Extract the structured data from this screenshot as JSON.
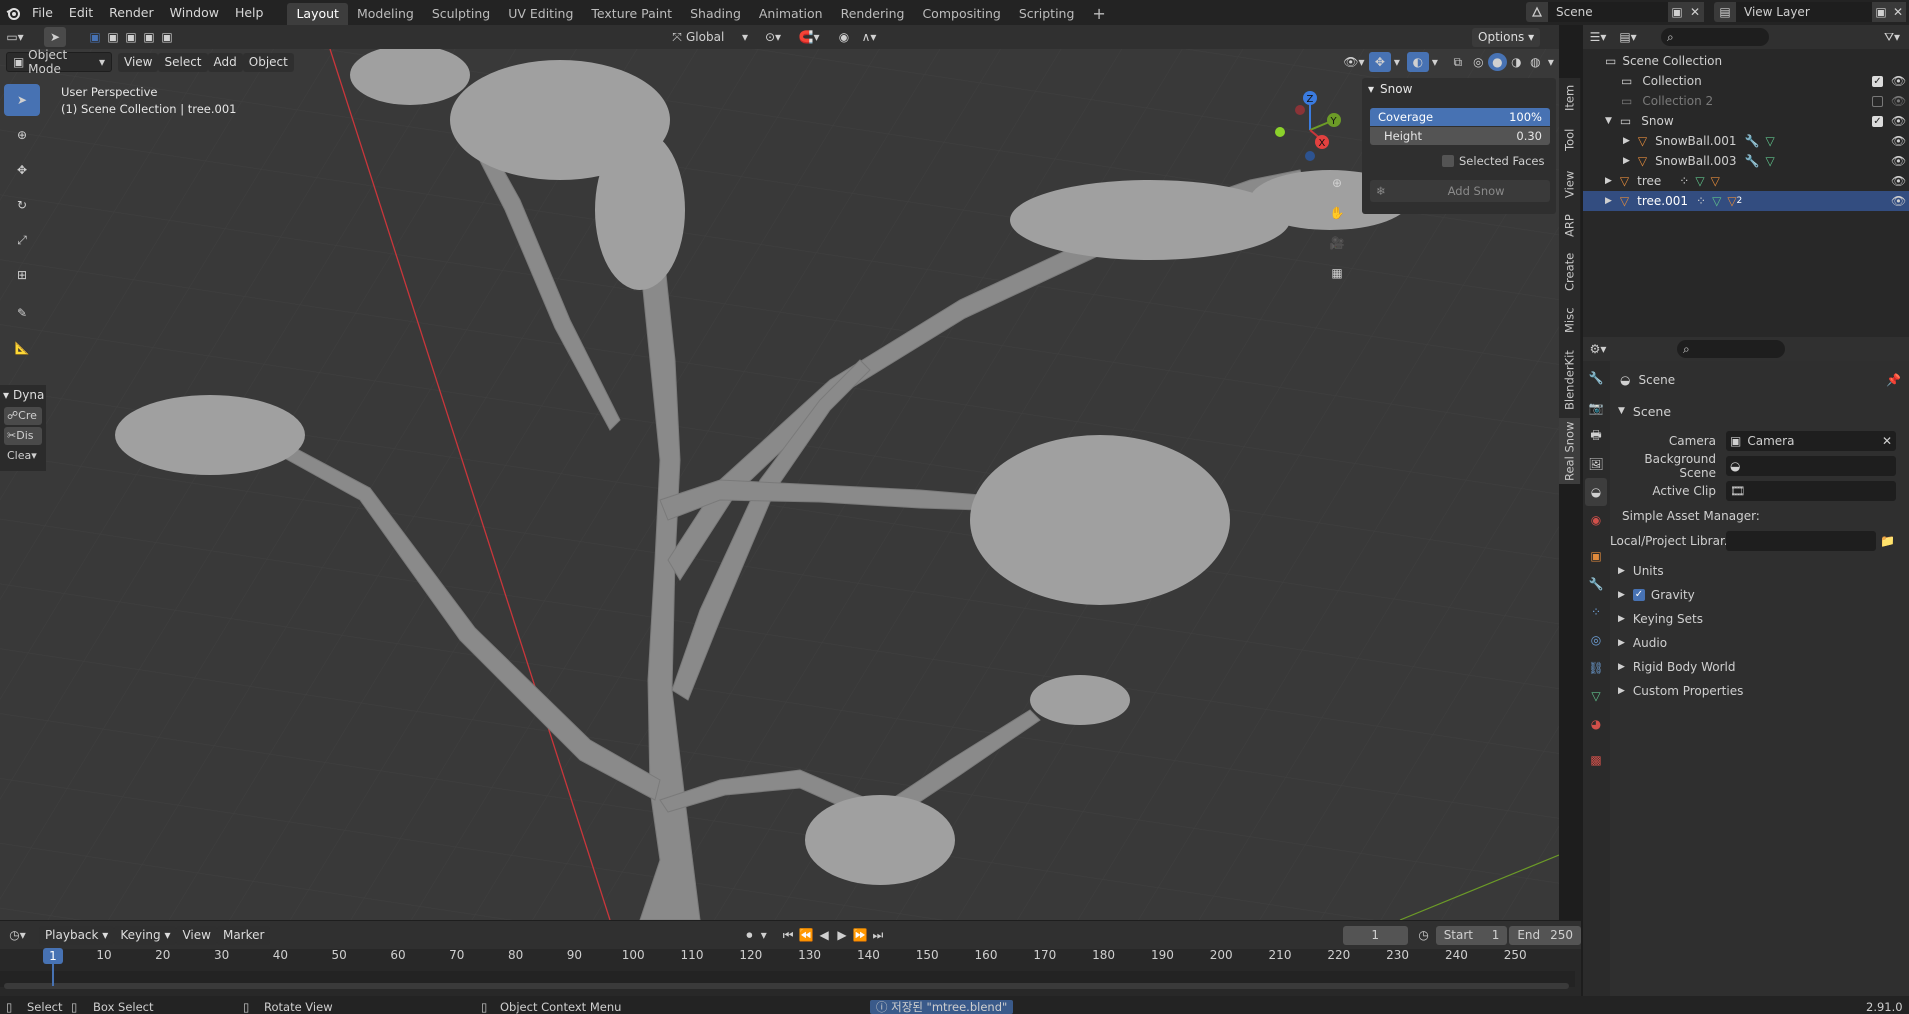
{
  "topbar": {
    "menus": [
      "File",
      "Edit",
      "Render",
      "Window",
      "Help"
    ],
    "workspaces": [
      "Layout",
      "Modeling",
      "Sculpting",
      "UV Editing",
      "Texture Paint",
      "Shading",
      "Animation",
      "Rendering",
      "Compositing",
      "Scripting"
    ],
    "active_workspace": "Layout",
    "scene_name": "Scene",
    "view_layer": "View Layer"
  },
  "viewport_header": {
    "mode": "Object Mode",
    "menus": [
      "View",
      "Select",
      "Add",
      "Object"
    ],
    "transform_orientation": "Global",
    "options_label": "Options"
  },
  "viewport": {
    "perspective_label": "User Perspective",
    "collection_label": "(1) Scene Collection | tree.001",
    "operator_panel": {
      "title": "Dyna",
      "items": [
        "Cre",
        "Dis",
        "Clea"
      ]
    }
  },
  "snow_panel": {
    "title": "Snow",
    "coverage_label": "Coverage",
    "coverage_value": "100%",
    "height_label": "Height",
    "height_value": "0.30",
    "selected_faces_label": "Selected Faces",
    "add_snow_label": "Add Snow"
  },
  "sidebar_tabs": [
    "Item",
    "Tool",
    "View",
    "ARP",
    "Create",
    "Misc",
    "BlenderKit",
    "Real Snow"
  ],
  "outliner": {
    "root": "Scene Collection",
    "items": [
      {
        "label": "Collection",
        "indent": 1
      },
      {
        "label": "Collection 2",
        "indent": 1
      },
      {
        "label": "Snow",
        "indent": 1
      },
      {
        "label": "SnowBall.001",
        "indent": 2
      },
      {
        "label": "SnowBall.003",
        "indent": 2
      },
      {
        "label": "tree",
        "indent": 1
      },
      {
        "label": "tree.001",
        "indent": 1
      }
    ],
    "tree001_badge": "2"
  },
  "properties": {
    "context_title": "Scene",
    "section_scene": "Scene",
    "camera_label": "Camera",
    "camera_value": "Camera",
    "background_scene_label": "Background Scene",
    "active_clip_label": "Active Clip",
    "sam_label": "Simple Asset Manager:",
    "local_library_label": "Local/Project Librar...",
    "sections": [
      "Units",
      "Gravity",
      "Keying Sets",
      "Audio",
      "Rigid Body World",
      "Custom Properties"
    ],
    "gravity_checked": true
  },
  "timeline": {
    "menus": [
      "Playback",
      "Keying",
      "View",
      "Marker"
    ],
    "current_frame": "1",
    "start_label": "Start",
    "start_value": "1",
    "end_label": "End",
    "end_value": "250",
    "ruler": [
      "10",
      "20",
      "30",
      "40",
      "50",
      "60",
      "70",
      "80",
      "90",
      "100",
      "110",
      "120",
      "130",
      "140",
      "150",
      "160",
      "170",
      "180",
      "190",
      "200",
      "210",
      "220",
      "230",
      "240",
      "250"
    ],
    "ruler_current": "1"
  },
  "statusbar": {
    "select": "Select",
    "box_select": "Box Select",
    "rotate_view": "Rotate View",
    "context_menu": "Object Context Menu",
    "message": "저장된 \"mtree.blend\"",
    "version": "2.91.0"
  },
  "colors": {
    "accent": "#4772b3",
    "object_orange": "#e08a3c",
    "mesh_green": "#5fc08a",
    "modifier_blue": "#6ea0d8",
    "axis_red": "#c9363b",
    "axis_green": "#6c9b27"
  }
}
